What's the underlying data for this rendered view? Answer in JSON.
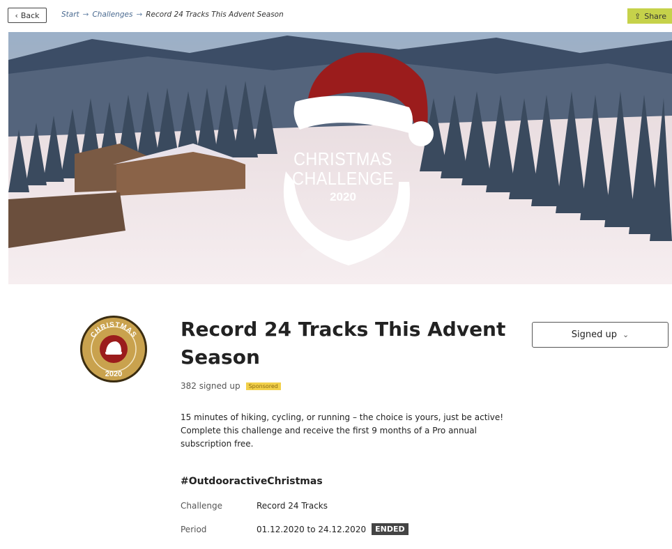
{
  "topbar": {
    "back_label": "Back",
    "breadcrumb": [
      "Start",
      "Challenges",
      "Record 24 Tracks This Advent Season"
    ],
    "share_label": "Share"
  },
  "hero": {
    "logo_line1": "CHRISTMAS",
    "logo_line2": "CHALLENGE",
    "logo_year": "2020"
  },
  "badge": {
    "top_text": "CHRISTMAS",
    "year": "2020"
  },
  "challenge": {
    "title": "Record 24 Tracks This Advent Season",
    "signed_up_button": "Signed up",
    "signed_count": "382 signed up",
    "sponsored": "Sponsored",
    "description": "15 minutes of hiking, cycling, or running – the choice is yours, just be active! Complete this challenge and receive the first 9 months of a Pro annual subscription free.",
    "hashtag": "#OutdooractiveChristmas",
    "details": {
      "challenge_label": "Challenge",
      "challenge_value": "Record 24 Tracks",
      "period_label": "Period",
      "period_value": "01.12.2020 to 24.12.2020",
      "status": "ENDED"
    }
  },
  "colors": {
    "share_bg": "#c6d24a",
    "sponsored_bg": "#f2d04a",
    "santa_red": "#9b1c1c",
    "badge_gold": "#c9a24e",
    "ended_bg": "#444444"
  }
}
